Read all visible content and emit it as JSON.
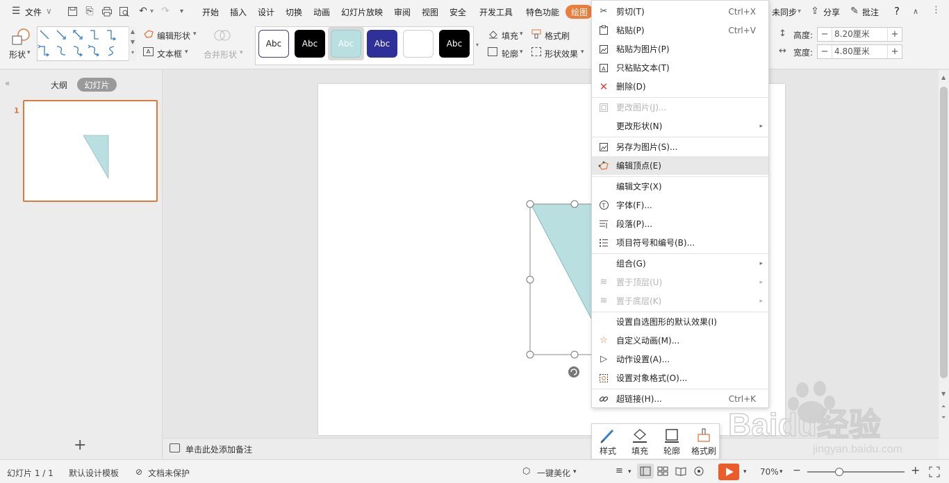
{
  "menubar": {
    "file_label": "文件",
    "tabs": [
      "开始",
      "插入",
      "设计",
      "切换",
      "动画",
      "幻灯片放映",
      "审阅",
      "视图",
      "安全",
      "开发工具",
      "特色功能"
    ],
    "active_tab": "绘图",
    "sync_label": "未同步",
    "share_label": "分享",
    "comment_label": "批注",
    "help_label": "?"
  },
  "ribbon": {
    "shape_label": "形状",
    "edit_shape_label": "编辑形状",
    "textbox_label": "文本框",
    "merge_shape_label": "合并形状",
    "style_samples": [
      "Abc",
      "Abc",
      "Abc",
      "Abc",
      "",
      "Abc"
    ],
    "fill_label": "填充",
    "format_brush_label": "格式刷",
    "outline_label": "轮廓",
    "shape_effect_label": "形状效果",
    "height_label": "高度:",
    "height_value": "8.20厘米",
    "width_label": "宽度:",
    "width_value": "4.80厘米"
  },
  "leftpanel": {
    "outline_tab": "大纲",
    "slides_tab": "幻灯片",
    "slide_number": "1",
    "add_symbol": "+"
  },
  "notes": {
    "placeholder": "单击此处添加备注"
  },
  "context_menu": {
    "items": [
      {
        "label": "剪切(T)",
        "shortcut": "Ctrl+X",
        "icon": "scissors-icon"
      },
      {
        "label": "粘贴(P)",
        "shortcut": "Ctrl+V",
        "icon": "paste-icon"
      },
      {
        "label": "粘贴为图片(P)",
        "shortcut": "",
        "icon": "paste-image-icon"
      },
      {
        "label": "只粘贴文本(T)",
        "shortcut": "",
        "icon": "paste-text-icon"
      },
      {
        "label": "删除(D)",
        "shortcut": "",
        "icon": "delete-icon"
      },
      {
        "label": "更改图片(J)...",
        "shortcut": "",
        "icon": "change-image-icon"
      },
      {
        "label": "更改形状(N)",
        "shortcut": "",
        "icon": ""
      },
      {
        "label": "另存为图片(S)...",
        "shortcut": "",
        "icon": "save-image-icon"
      },
      {
        "label": "编辑顶点(E)",
        "shortcut": "",
        "icon": "edit-points-icon"
      },
      {
        "label": "编辑文字(X)",
        "shortcut": "",
        "icon": ""
      },
      {
        "label": "字体(F)...",
        "shortcut": "",
        "icon": "font-icon"
      },
      {
        "label": "段落(P)...",
        "shortcut": "",
        "icon": "paragraph-icon"
      },
      {
        "label": "项目符号和编号(B)...",
        "shortcut": "",
        "icon": "bullets-icon"
      },
      {
        "label": "组合(G)",
        "shortcut": "",
        "icon": ""
      },
      {
        "label": "置于顶层(U)",
        "shortcut": "",
        "icon": "bring-front-icon"
      },
      {
        "label": "置于底层(K)",
        "shortcut": "",
        "icon": "send-back-icon"
      },
      {
        "label": "设置自选图形的默认效果(I)",
        "shortcut": "",
        "icon": ""
      },
      {
        "label": "自定义动画(M)...",
        "shortcut": "",
        "icon": "animation-icon"
      },
      {
        "label": "动作设置(A)...",
        "shortcut": "",
        "icon": "action-icon"
      },
      {
        "label": "设置对象格式(O)...",
        "shortcut": "",
        "icon": "format-object-icon"
      },
      {
        "label": "超链接(H)...",
        "shortcut": "Ctrl+K",
        "icon": "hyperlink-icon"
      }
    ]
  },
  "floatbar": {
    "style_label": "样式",
    "fill_label": "填充",
    "outline_label": "轮廓",
    "brush_label": "格式刷"
  },
  "statusbar": {
    "slide_info": "幻灯片 1 / 1",
    "template": "默认设计模板",
    "protection": "文档未保护",
    "beautify": "一键美化",
    "zoom": "70%"
  },
  "watermark": {
    "brand": "Baidu经验",
    "url": "jingyan.baidu.com"
  },
  "colors": {
    "accent": "#ec7c3a",
    "shape_fill": "#b9dfe1",
    "arrow": "#e8352a"
  }
}
